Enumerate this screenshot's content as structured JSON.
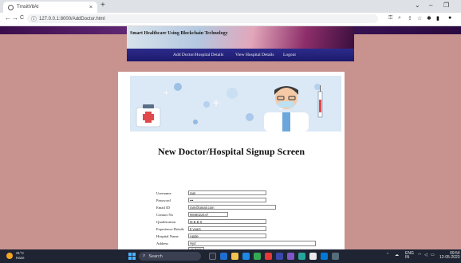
{
  "browser": {
    "tab_title": "TrnsitVitAt",
    "tab_close": "×",
    "new_tab": "+",
    "win_minimize": "–",
    "win_restore": "❐",
    "url": "127.0.0.1:8000/AddDoctor.html",
    "back": "←",
    "forward": "→",
    "reload": "C",
    "info": "ⓘ"
  },
  "site": {
    "title": "Smart Healthcare Using Blockchain Technology",
    "nav": [
      {
        "label": "Add Doctor/Hospital Details"
      },
      {
        "label": "View Hospital Details"
      },
      {
        "label": "Logout"
      }
    ]
  },
  "form": {
    "heading": "New Doctor/Hospital Signup Screen",
    "fields": [
      {
        "label": "Username",
        "value": "ram"
      },
      {
        "label": "Password",
        "value": "•••"
      },
      {
        "label": "Email ID",
        "value": "ram@gmail.com"
      },
      {
        "label": "Contact No",
        "value": "9848022447"
      },
      {
        "label": "Qualification",
        "value": "M.B.B.S"
      },
      {
        "label": "Experience Details",
        "value": "5 years"
      },
      {
        "label": "Hospital Name",
        "value": "Apple"
      },
      {
        "label": "Address",
        "value": "Hyd"
      }
    ],
    "submit_label": "Submit"
  },
  "taskbar": {
    "weather_temp": "31°C",
    "weather_desc": "Haze",
    "search_placeholder": "Search",
    "search_icon": "⌕",
    "lang": "ENG",
    "lang_sub": "IN",
    "time": "09:54",
    "date": "12-05-2023"
  },
  "colors": {
    "page_bg": "#c8928f",
    "nav_bg": "#2c2b8c",
    "taskbar_bg": "#1f2433"
  }
}
